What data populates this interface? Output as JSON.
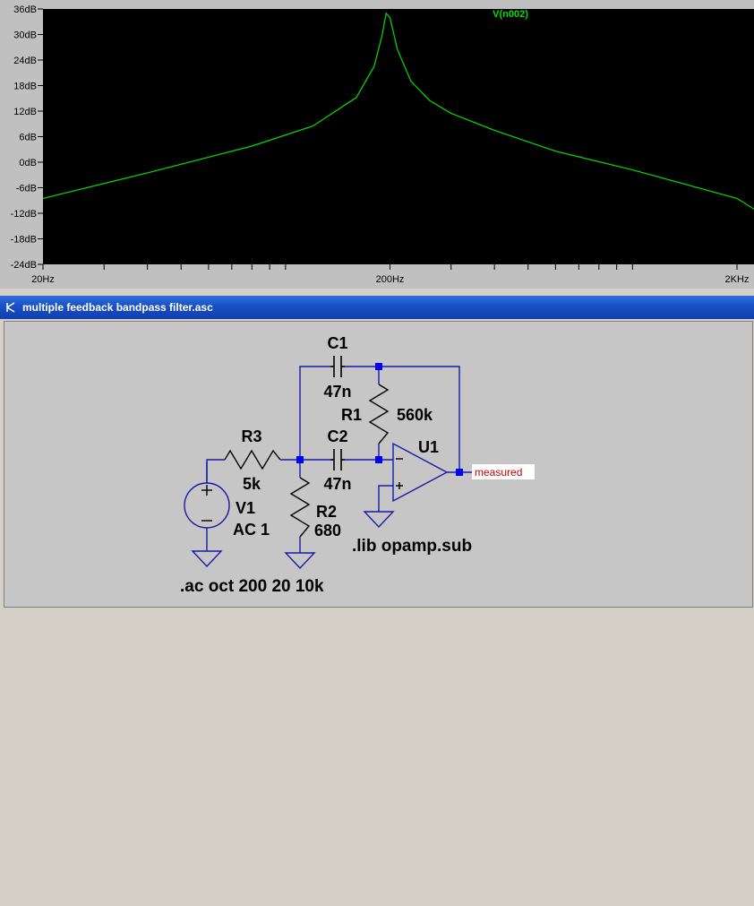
{
  "waveform": {
    "trace_name": "V(n002)",
    "trace_color": "#00e000",
    "y_ticks": [
      "36dB",
      "30dB",
      "24dB",
      "18dB",
      "12dB",
      "6dB",
      "0dB",
      "-6dB",
      "-12dB",
      "-18dB",
      "-24dB"
    ],
    "x_ticks": [
      "20Hz",
      "200Hz",
      "2KHz"
    ]
  },
  "chart_data": {
    "type": "line",
    "xlabel": "",
    "ylabel": "",
    "x_scale": "log",
    "xlim": [
      20,
      2500
    ],
    "ylim": [
      -24,
      36
    ],
    "series": [
      {
        "name": "V(n002)",
        "x": [
          20,
          40,
          80,
          120,
          160,
          180,
          190,
          195,
          200,
          210,
          230,
          260,
          300,
          400,
          600,
          1000,
          2000,
          2500
        ],
        "y": [
          -8.5,
          -2.5,
          3.8,
          8.5,
          15.2,
          22.5,
          30.0,
          35.0,
          34.0,
          26.5,
          19.0,
          14.5,
          11.5,
          7.5,
          2.6,
          -1.8,
          -8.5,
          -11.0
        ]
      }
    ]
  },
  "schematic": {
    "window_title": "multiple feedback bandpass filter.asc",
    "components": {
      "c1": {
        "name": "C1",
        "value": "47n"
      },
      "c2": {
        "name": "C2",
        "value": "47n"
      },
      "r1": {
        "name": "R1",
        "value": "560k"
      },
      "r2": {
        "name": "R2",
        "value": "680"
      },
      "r3": {
        "name": "R3",
        "value": "5k"
      },
      "v1": {
        "name": "V1",
        "value": "AC 1"
      },
      "u1": {
        "name": "U1"
      }
    },
    "net_label": "measured",
    "directive_ac": ".ac oct 200 20 10k",
    "directive_lib": ".lib opamp.sub",
    "colors": {
      "wire": "#1a1aa8",
      "node": "#0000ff",
      "net_label": "#c00000"
    }
  }
}
